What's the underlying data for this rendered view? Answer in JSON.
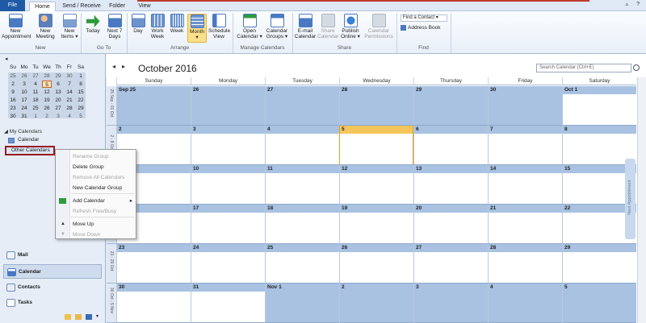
{
  "tabs": [
    "File",
    "Home",
    "Send / Receive",
    "Folder",
    "View"
  ],
  "ribbon": {
    "buttons": [
      {
        "l1": "New",
        "l2": "Appointment"
      },
      {
        "l1": "New",
        "l2": "Meeting"
      },
      {
        "l1": "New",
        "l2": "Items ▾"
      },
      {
        "l1": "Today",
        "l2": ""
      },
      {
        "l1": "Next 7",
        "l2": "Days"
      },
      {
        "l1": "Day",
        "l2": ""
      },
      {
        "l1": "Work",
        "l2": "Week"
      },
      {
        "l1": "Week",
        "l2": ""
      },
      {
        "l1": "Month",
        "l2": "▾"
      },
      {
        "l1": "Schedule",
        "l2": "View"
      },
      {
        "l1": "Open",
        "l2": "Calendar ▾"
      },
      {
        "l1": "Calendar",
        "l2": "Groups ▾"
      },
      {
        "l1": "E-mail",
        "l2": "Calendar"
      },
      {
        "l1": "Share",
        "l2": "Calendar"
      },
      {
        "l1": "Publish",
        "l2": "Online ▾"
      },
      {
        "l1": "Calendar",
        "l2": "Permissions"
      }
    ],
    "find_contact": "Find a Contact ▾",
    "address_book": "Address Book",
    "groups": [
      "New",
      "Go To",
      "Arrange",
      "Manage Calendars",
      "Share",
      "Find"
    ]
  },
  "mini": {
    "title": "October 2016",
    "days": [
      "Su",
      "Mo",
      "Tu",
      "We",
      "Th",
      "Fr",
      "Sa"
    ],
    "rows": [
      [
        "25",
        "26",
        "27",
        "28",
        "29",
        "30",
        "1"
      ],
      [
        "2",
        "3",
        "4",
        "5",
        "6",
        "7",
        "8"
      ],
      [
        "9",
        "10",
        "11",
        "12",
        "13",
        "14",
        "15"
      ],
      [
        "16",
        "17",
        "18",
        "19",
        "20",
        "21",
        "22"
      ],
      [
        "23",
        "24",
        "25",
        "26",
        "27",
        "28",
        "29"
      ],
      [
        "30",
        "31",
        "1",
        "2",
        "3",
        "4",
        "5"
      ]
    ]
  },
  "nav": {
    "my_calendars": "◢ My Calendars",
    "calendar": "Calendar",
    "other_calendars": "Other Calendars",
    "buttons": [
      "Mail",
      "Calendar",
      "Contacts",
      "Tasks"
    ]
  },
  "context_menu": [
    {
      "label": "Rename Group",
      "disabled": true
    },
    {
      "label": "Delete Group",
      "disabled": false
    },
    {
      "label": "Remove All Calendars",
      "disabled": true
    },
    {
      "label": "New Calendar Group",
      "disabled": false
    },
    {
      "label": "Add Calendar",
      "disabled": false,
      "arrow": "▸"
    },
    {
      "label": "Refresh Free/Busy",
      "disabled": true
    },
    {
      "label": "Move Up",
      "disabled": false
    },
    {
      "label": "Move Down",
      "disabled": true
    }
  ],
  "calendar": {
    "month_title": "October 2016",
    "search_placeholder": "Search Calendar (Ctrl+E)",
    "day_names": [
      "Sunday",
      "Monday",
      "Tuesday",
      "Wednesday",
      "Thursday",
      "Friday",
      "Saturday"
    ],
    "week_labels": [
      "25 Sep - 01 Oct",
      "2 - 8 Oct",
      "9 - 15 Oct",
      "16 - 22 Oct",
      "23 - 29 Oct",
      "30 Oct - 5 Nov"
    ],
    "weeks": [
      [
        "Sep 25",
        "26",
        "27",
        "28",
        "29",
        "30",
        "Oct 1"
      ],
      [
        "2",
        "3",
        "4",
        "5",
        "6",
        "7",
        "8"
      ],
      [
        "9",
        "10",
        "11",
        "12",
        "13",
        "14",
        "15"
      ],
      [
        "16",
        "17",
        "18",
        "19",
        "20",
        "21",
        "22"
      ],
      [
        "23",
        "24",
        "25",
        "26",
        "27",
        "28",
        "29"
      ],
      [
        "30",
        "31",
        "Nov 1",
        "2",
        "3",
        "4",
        "5"
      ]
    ],
    "out_of_month": [
      [
        0,
        1,
        2,
        3,
        4,
        5
      ],
      [],
      [],
      [],
      [],
      [
        2,
        3,
        4,
        5,
        6
      ]
    ],
    "today": [
      1,
      3
    ],
    "next_appointment": "Next Appointment"
  }
}
